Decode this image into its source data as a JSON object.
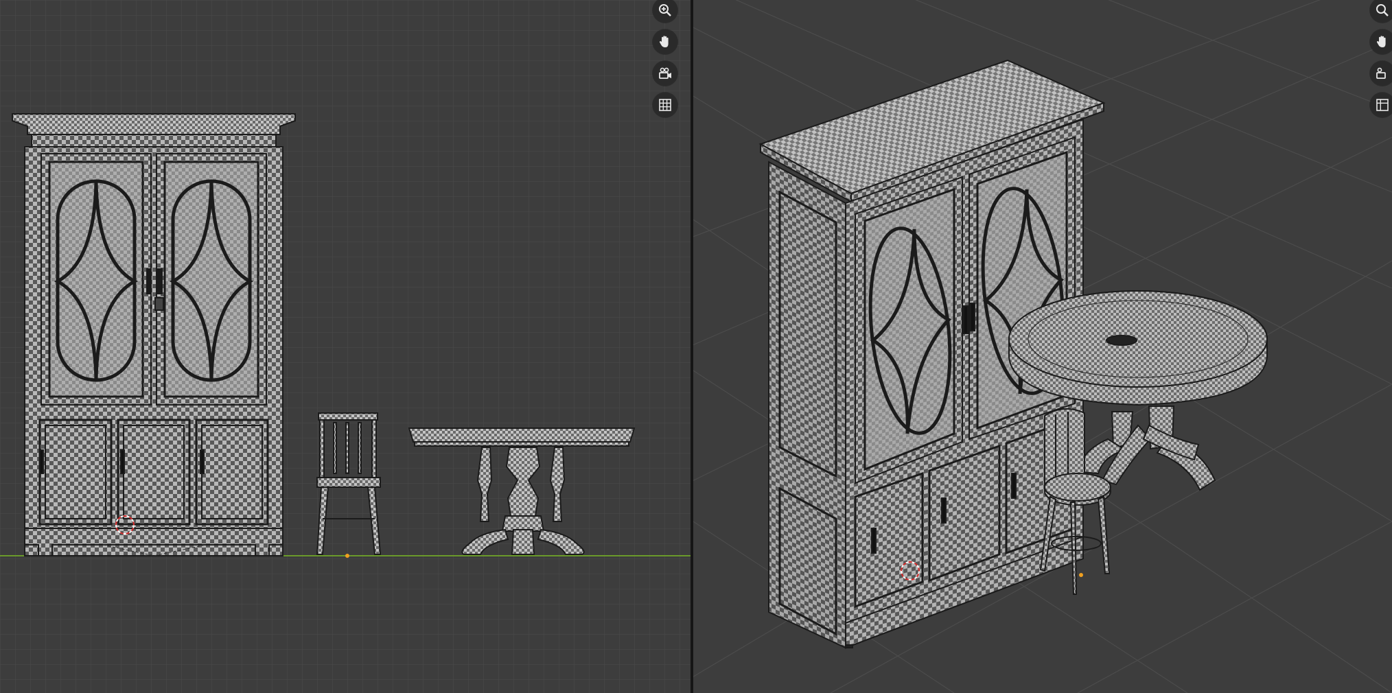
{
  "left_viewport": {
    "view": "front-orthographic",
    "gizmo_tools": [
      {
        "icon": "zoom-icon"
      },
      {
        "icon": "hand-pan-icon"
      },
      {
        "icon": "camera-icon"
      },
      {
        "icon": "grid-icon"
      }
    ]
  },
  "right_viewport": {
    "view": "user-perspective",
    "gizmo_tools": [
      {
        "icon": "zoom-icon"
      },
      {
        "icon": "hand-pan-icon"
      },
      {
        "icon": "camera-icon"
      },
      {
        "icon": "grid-icon"
      }
    ]
  },
  "colors": {
    "viewport_bg": "#3d3d3d",
    "grid_line": "#4a4a4a",
    "grid_major": "#555555",
    "ground_line": "#6a9a2a",
    "checker_light": "#b9b9b9",
    "checker_dark": "#5a5a5a",
    "wire": "#1b1b1b",
    "cursor_red": "#d42a2a",
    "origin_orange": "#f0a020"
  }
}
